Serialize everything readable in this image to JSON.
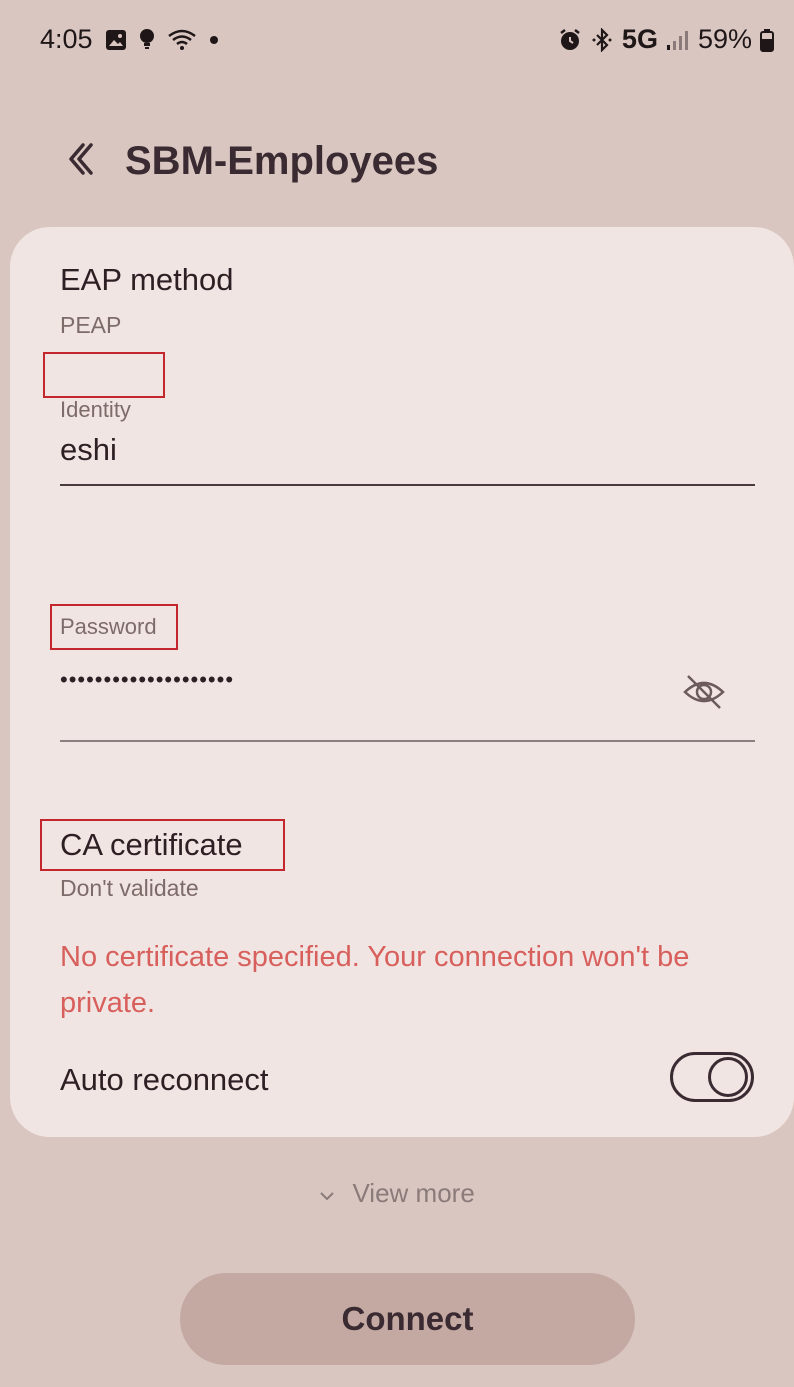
{
  "status_bar": {
    "time": "4:05",
    "network": "5G",
    "battery": "59%",
    "left_icons": [
      "gallery-icon",
      "bulb-icon",
      "wifi-icon",
      "dot-icon"
    ],
    "right_icons": [
      "alarm-icon",
      "bluetooth-icon",
      "signal-icon",
      "battery-icon"
    ]
  },
  "header": {
    "title": "SBM-Employees",
    "back_icon": "back-chevron-icon"
  },
  "form": {
    "eap_method_label": "EAP method",
    "eap_method_value": "PEAP",
    "identity_label": "Identity",
    "identity_value": "eshi",
    "password_label": "Password",
    "password_value": "••••••••••••••••••••",
    "password_visibility_icon": "eye-off-icon",
    "ca_cert_label": "CA certificate",
    "ca_cert_value": "Don't validate",
    "warning": "No certificate specified. Your connection won't be private.",
    "auto_reconnect_label": "Auto reconnect",
    "auto_reconnect_on": true
  },
  "footer": {
    "view_more": "View more",
    "connect": "Connect"
  },
  "colors": {
    "background": "#d9c6c0",
    "card": "#f1e5e3",
    "warning": "#d7605d",
    "highlight_box": "#c3262d",
    "connect_button": "#c4a9a2"
  }
}
